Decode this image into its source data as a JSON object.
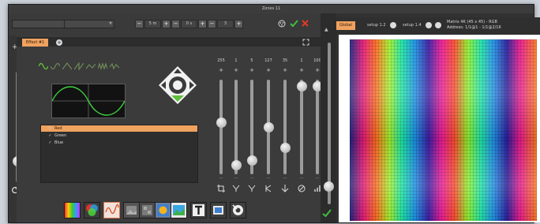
{
  "window": {
    "title": "Zones 11"
  },
  "toolbar": {
    "left_combo": "",
    "mid_combo": "",
    "dim1_value": "5 m",
    "dim2_value": "0 s",
    "dim3_value": "3"
  },
  "effect_tab": {
    "label": "Effect #1"
  },
  "list_items": [
    {
      "label": "Red",
      "icon": "cycle-icon",
      "selected": true
    },
    {
      "label": "Green",
      "icon": "checkmark-icon",
      "selected": false
    },
    {
      "label": "Blue",
      "icon": "checkmark-icon",
      "selected": false
    }
  ],
  "sliders": [
    {
      "value": "255",
      "level": 0.55,
      "icon": "crop-icon"
    },
    {
      "value": "1",
      "level": 0.05,
      "icon": "funnel-icon"
    },
    {
      "value": "5",
      "level": 0.1,
      "icon": "funnel-icon"
    },
    {
      "value": "127",
      "level": 0.5,
      "icon": "merge-icon"
    },
    {
      "value": "35",
      "level": 0.25,
      "icon": "arrow-down-icon"
    },
    {
      "value": "1",
      "level": 0.98,
      "icon": "no-entry-icon"
    },
    {
      "value": "100",
      "level": 0.98,
      "icon": "bars-icon"
    }
  ],
  "matrix_tabs": [
    {
      "label": "Global",
      "active": true
    },
    {
      "label": "setup 1.2",
      "active": false
    },
    {
      "label": "setup 1.4",
      "active": false
    }
  ],
  "matrix_info": {
    "line1": "Matrix 4K (45 x 45) - RGB",
    "line2": "Address: 1/1@1 - 1/1@2/16"
  },
  "colors": {
    "accent": "#f0a25f",
    "apply": "#3fbf3f",
    "cancel": "#e2382b"
  }
}
